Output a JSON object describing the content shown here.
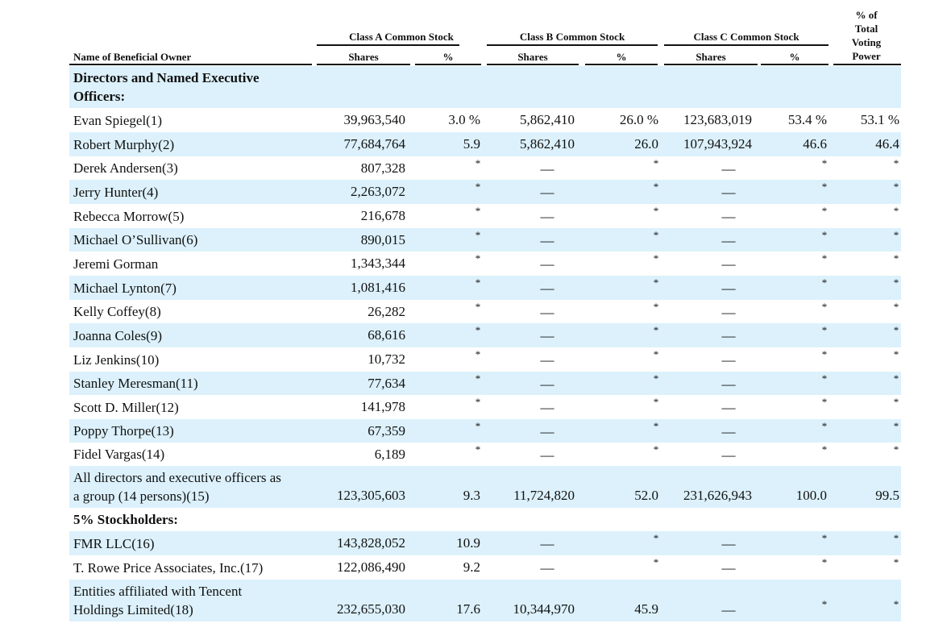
{
  "headers": {
    "name_col": "Name of Beneficial Owner",
    "class_a": "Class A Common Stock",
    "class_b": "Class B Common Stock",
    "class_c": "Class C Common Stock",
    "shares": "Shares",
    "pct": "%",
    "voting_power": [
      "% of",
      "Total",
      "Voting",
      "Power"
    ]
  },
  "rows": [
    {
      "type": "section",
      "name": [
        "Directors and Named Executive",
        "Officers:"
      ]
    },
    {
      "name": [
        "Evan Spiegel(1)"
      ],
      "a_sh": "39,963,540",
      "a_pct": "3.0 %",
      "b_sh": "5,862,410",
      "b_pct": "26.0 %",
      "c_sh": "123,683,019",
      "c_pct": "53.4 %",
      "vote": "53.1 %"
    },
    {
      "name": [
        "Robert Murphy(2)"
      ],
      "a_sh": "77,684,764",
      "a_pct": "5.9",
      "b_sh": "5,862,410",
      "b_pct": "26.0",
      "c_sh": "107,943,924",
      "c_pct": "46.6",
      "vote": "46.4"
    },
    {
      "name": [
        "Derek Andersen(3)"
      ],
      "a_sh": "807,328",
      "a_pct": "*",
      "b_sh": "—",
      "b_pct": "*",
      "c_sh": "—",
      "c_pct": "*",
      "vote": "*"
    },
    {
      "name": [
        "Jerry Hunter(4)"
      ],
      "a_sh": "2,263,072",
      "a_pct": "*",
      "b_sh": "—",
      "b_pct": "*",
      "c_sh": "—",
      "c_pct": "*",
      "vote": "*"
    },
    {
      "name": [
        "Rebecca Morrow(5)"
      ],
      "a_sh": "216,678",
      "a_pct": "*",
      "b_sh": "—",
      "b_pct": "*",
      "c_sh": "—",
      "c_pct": "*",
      "vote": "*"
    },
    {
      "name": [
        "Michael O’Sullivan(6)"
      ],
      "a_sh": "890,015",
      "a_pct": "*",
      "b_sh": "—",
      "b_pct": "*",
      "c_sh": "—",
      "c_pct": "*",
      "vote": "*"
    },
    {
      "name": [
        "Jeremi Gorman"
      ],
      "a_sh": "1,343,344",
      "a_pct": "*",
      "b_sh": "—",
      "b_pct": "*",
      "c_sh": "—",
      "c_pct": "*",
      "vote": "*"
    },
    {
      "name": [
        "Michael Lynton(7)"
      ],
      "a_sh": "1,081,416",
      "a_pct": "*",
      "b_sh": "—",
      "b_pct": "*",
      "c_sh": "—",
      "c_pct": "*",
      "vote": "*"
    },
    {
      "name": [
        "Kelly Coffey(8)"
      ],
      "a_sh": "26,282",
      "a_pct": "*",
      "b_sh": "—",
      "b_pct": "*",
      "c_sh": "—",
      "c_pct": "*",
      "vote": "*"
    },
    {
      "name": [
        "Joanna Coles(9)"
      ],
      "a_sh": "68,616",
      "a_pct": "*",
      "b_sh": "—",
      "b_pct": "*",
      "c_sh": "—",
      "c_pct": "*",
      "vote": "*"
    },
    {
      "name": [
        "Liz Jenkins(10)"
      ],
      "a_sh": "10,732",
      "a_pct": "*",
      "b_sh": "—",
      "b_pct": "*",
      "c_sh": "—",
      "c_pct": "*",
      "vote": "*"
    },
    {
      "name": [
        "Stanley Meresman(11)"
      ],
      "a_sh": "77,634",
      "a_pct": "*",
      "b_sh": "—",
      "b_pct": "*",
      "c_sh": "—",
      "c_pct": "*",
      "vote": "*"
    },
    {
      "name": [
        "Scott D. Miller(12)"
      ],
      "a_sh": "141,978",
      "a_pct": "*",
      "b_sh": "—",
      "b_pct": "*",
      "c_sh": "—",
      "c_pct": "*",
      "vote": "*"
    },
    {
      "name": [
        "Poppy Thorpe(13)"
      ],
      "a_sh": "67,359",
      "a_pct": "*",
      "b_sh": "—",
      "b_pct": "*",
      "c_sh": "—",
      "c_pct": "*",
      "vote": "*"
    },
    {
      "name": [
        "Fidel Vargas(14)"
      ],
      "a_sh": "6,189",
      "a_pct": "*",
      "b_sh": "—",
      "b_pct": "*",
      "c_sh": "—",
      "c_pct": "*",
      "vote": "*"
    },
    {
      "name": [
        "All directors and executive officers as",
        "a group (14 persons)(15)"
      ],
      "a_sh": "123,305,603",
      "a_pct": "9.3",
      "b_sh": "11,724,820",
      "b_pct": "52.0",
      "c_sh": "231,626,943",
      "c_pct": "100.0",
      "vote": "99.5"
    },
    {
      "type": "section",
      "name": [
        "5% Stockholders:"
      ]
    },
    {
      "name": [
        "FMR LLC(16)"
      ],
      "a_sh": "143,828,052",
      "a_pct": "10.9",
      "b_sh": "—",
      "b_pct": "*",
      "c_sh": "—",
      "c_pct": "*",
      "vote": "*"
    },
    {
      "name": [
        "T. Rowe Price Associates, Inc.(17)"
      ],
      "a_sh": "122,086,490",
      "a_pct": "9.2",
      "b_sh": "—",
      "b_pct": "*",
      "c_sh": "—",
      "c_pct": "*",
      "vote": "*"
    },
    {
      "name": [
        "Entities affiliated with Tencent",
        "Holdings Limited(18)"
      ],
      "a_sh": "232,655,030",
      "a_pct": "17.6",
      "b_sh": "10,344,970",
      "b_pct": "45.9",
      "c_sh": "—",
      "c_pct": "*",
      "vote": "*"
    }
  ]
}
